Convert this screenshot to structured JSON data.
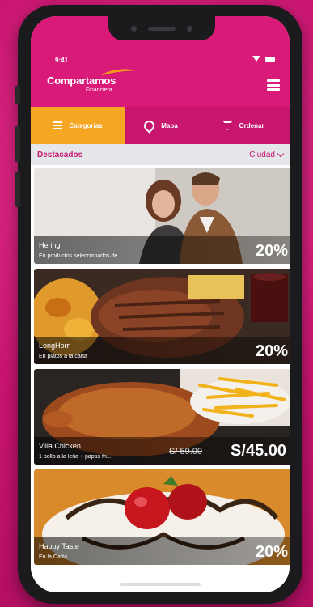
{
  "status": {
    "time": "9:41"
  },
  "brand": {
    "name": "Compartamos",
    "sub": "Financiera"
  },
  "tabs": [
    {
      "label": "Categorias",
      "icon": "filter-icon"
    },
    {
      "label": "Mapa",
      "icon": "map-pin-icon"
    },
    {
      "label": "Ordenar",
      "icon": "funnel-icon"
    }
  ],
  "section": {
    "title": "Destacados",
    "filter_label": "Ciudad"
  },
  "cards": [
    {
      "name": "Hering",
      "desc": "En productos seleccionados de ...",
      "discount": "20%"
    },
    {
      "name": "LongHorn",
      "desc": "En platos a la carta",
      "discount": "20%"
    },
    {
      "name": "Villa Chicken",
      "desc": "1 pollo a la leña + papas fri...",
      "old_price": "S/ 59.00",
      "new_price": "S/45.00"
    },
    {
      "name": "Happy Taste",
      "desc": "En la Carta",
      "discount": "20%"
    }
  ],
  "colors": {
    "brand": "#d91a78",
    "accent": "#f5a623",
    "bar": "#e4e6ea"
  }
}
